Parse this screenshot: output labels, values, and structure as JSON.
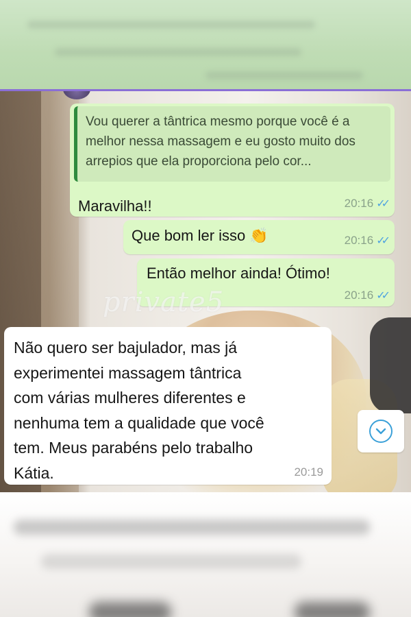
{
  "colors": {
    "outgoing_bubble": "#dcf8c6",
    "incoming_bubble": "#ffffff",
    "quote_bar": "#2e8b3e",
    "read_ticks": "#4fa3e0",
    "accent_line": "#8a6fd6"
  },
  "watermark": "private5",
  "messages": [
    {
      "direction": "outgoing",
      "quoted_text": "Vou querer a tântrica mesmo porque você é a melhor nessa massagem e eu gosto muito dos arrepios que ela proporciona pelo cor...",
      "text": "Maravilha!!",
      "time": "20:16",
      "status_icon": "double-check-read-icon"
    },
    {
      "direction": "outgoing",
      "text": "Que bom ler isso",
      "emoji": "👏",
      "time": "20:16",
      "status_icon": "double-check-read-icon"
    },
    {
      "direction": "outgoing",
      "text": "Então melhor ainda! Ótimo!",
      "time": "20:16",
      "status_icon": "double-check-read-icon"
    },
    {
      "direction": "incoming",
      "text": "Não quero ser bajulador, mas já\nexperimentei massagem tântrica\ncom várias mulheres diferentes e\nnenhuma tem a qualidade que você\ntem. Meus parabéns pelo trabalho\nKátia.",
      "time": "20:19"
    }
  ],
  "scroll_button": {
    "icon": "chevron-down-icon"
  }
}
